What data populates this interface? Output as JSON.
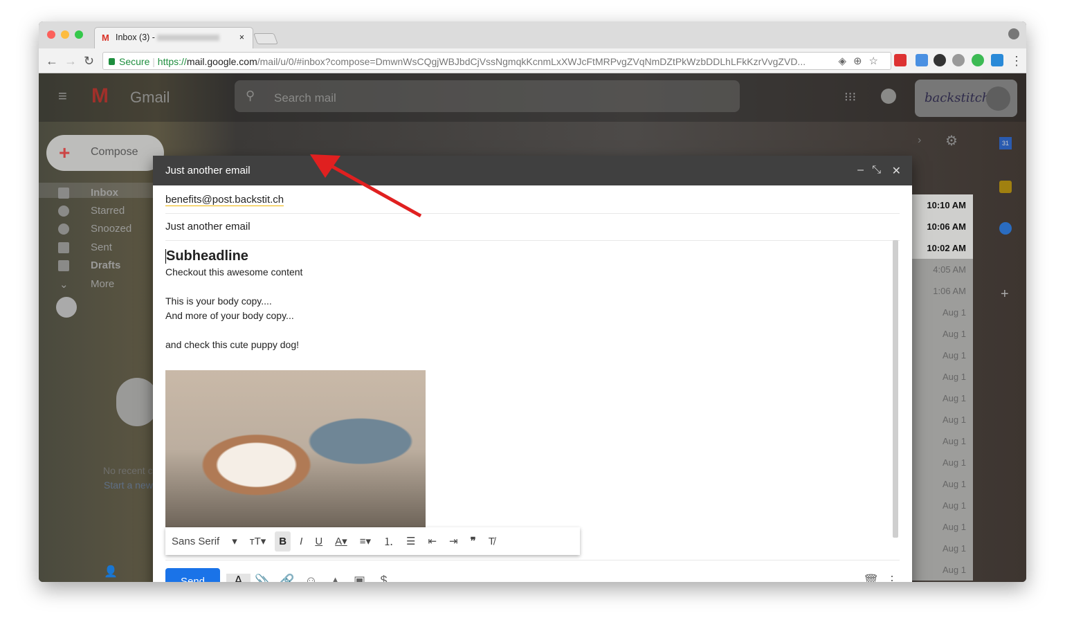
{
  "browser": {
    "tab_title": "Inbox (3) -",
    "url_secure": "Secure",
    "url_scheme": "https://",
    "url_host": "mail.google.com",
    "url_path": "/mail/u/0/#inbox?compose=DmwnWsCQgjWBJbdCjVssNgmqkKcnmLxXWJcFtMRPvgZVqNmDZtPkWzbDDLhLFkKzrVvgZVD..."
  },
  "gmail": {
    "logo": "Gmail",
    "search_placeholder": "Search mail",
    "compose": "Compose",
    "backstitch": "backstitch",
    "nav": [
      "Inbox",
      "Starred",
      "Snoozed",
      "Sent",
      "Drafts",
      "More"
    ],
    "hangouts": {
      "no_recent": "No recent c",
      "start_new": "Start a new"
    },
    "times": [
      "10:10 AM",
      "10:06 AM",
      "10:02 AM",
      "4:05 AM",
      "1:06 AM",
      "Aug 1",
      "Aug 1",
      "Aug 1",
      "Aug 1",
      "Aug 1",
      "Aug 1",
      "Aug 1",
      "Aug 1",
      "Aug 1",
      "Aug 1",
      "Aug 1",
      "Aug 1",
      "Aug 1"
    ],
    "calendar_day": "31"
  },
  "compose": {
    "title": "Just another email",
    "to": "benefits@post.backstit.ch",
    "subject": "Just another email",
    "body": {
      "headline": "Subheadline",
      "line1": "Checkout this awesome content",
      "line2": "This is your body copy....",
      "line3": "And more of your body copy...",
      "line4": "and check this cute puppy dog!"
    },
    "font": "Sans Serif",
    "send": "Send"
  },
  "colors": {
    "send": "#1a73e8",
    "arrow": "#e02020",
    "header": "#404040"
  }
}
